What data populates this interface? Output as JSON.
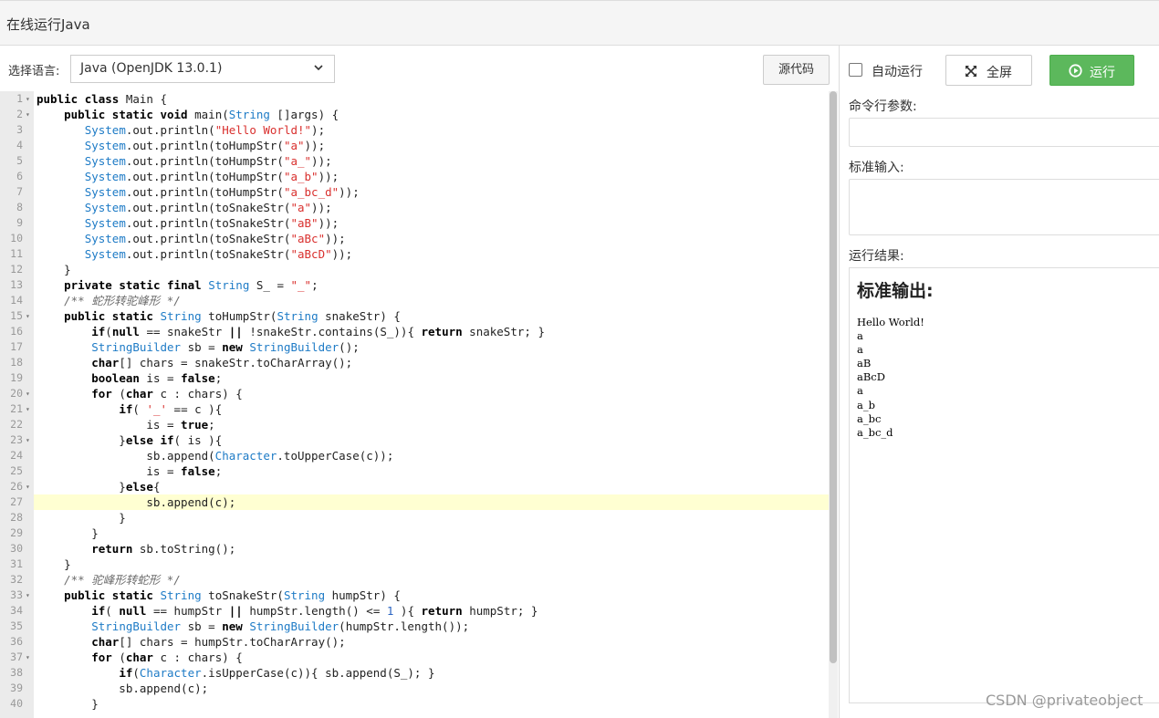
{
  "header": {
    "title": "在线运行Java"
  },
  "language": {
    "label": "选择语言:",
    "selected": "Java (OpenJDK 13.0.1)"
  },
  "toolbar": {
    "source_label": "源代码",
    "auto_run_label": "自动运行",
    "fullscreen_label": "全屏",
    "run_label": "运行",
    "run_color": "#5cb85c"
  },
  "editor": {
    "active_line": 27,
    "lines": [
      {
        "n": "1",
        "fold": true,
        "html": "<span class=\"kw\">public</span> <span class=\"kw\">class</span> Main {"
      },
      {
        "n": "2",
        "fold": true,
        "html": "    <span class=\"kw\">public</span> <span class=\"kw\">static</span> <span class=\"kw\">void</span> main(<span class=\"ty\">String</span> []args) {"
      },
      {
        "n": "3",
        "fold": false,
        "html": "       <span class=\"ty\">System</span>.out.println(<span class=\"st\">\"Hello World!\"</span>);"
      },
      {
        "n": "4",
        "fold": false,
        "html": "       <span class=\"ty\">System</span>.out.println(toHumpStr(<span class=\"st\">\"a\"</span>));"
      },
      {
        "n": "5",
        "fold": false,
        "html": "       <span class=\"ty\">System</span>.out.println(toHumpStr(<span class=\"st\">\"a_\"</span>));"
      },
      {
        "n": "6",
        "fold": false,
        "html": "       <span class=\"ty\">System</span>.out.println(toHumpStr(<span class=\"st\">\"a_b\"</span>));"
      },
      {
        "n": "7",
        "fold": false,
        "html": "       <span class=\"ty\">System</span>.out.println(toHumpStr(<span class=\"st\">\"a_bc_d\"</span>));"
      },
      {
        "n": "8",
        "fold": false,
        "html": "       <span class=\"ty\">System</span>.out.println(toSnakeStr(<span class=\"st\">\"a\"</span>));"
      },
      {
        "n": "9",
        "fold": false,
        "html": "       <span class=\"ty\">System</span>.out.println(toSnakeStr(<span class=\"st\">\"aB\"</span>));"
      },
      {
        "n": "10",
        "fold": false,
        "html": "       <span class=\"ty\">System</span>.out.println(toSnakeStr(<span class=\"st\">\"aBc\"</span>));"
      },
      {
        "n": "11",
        "fold": false,
        "html": "       <span class=\"ty\">System</span>.out.println(toSnakeStr(<span class=\"st\">\"aBcD\"</span>));"
      },
      {
        "n": "12",
        "fold": false,
        "html": "    }"
      },
      {
        "n": "13",
        "fold": false,
        "html": "    <span class=\"kw\">private</span> <span class=\"kw\">static</span> <span class=\"kw\">final</span> <span class=\"ty\">String</span> S_ = <span class=\"st\">\"_\"</span>;"
      },
      {
        "n": "14",
        "fold": false,
        "html": "    <span class=\"cm\">/** 蛇形转驼峰形 */</span>"
      },
      {
        "n": "15",
        "fold": true,
        "html": "    <span class=\"kw\">public</span> <span class=\"kw\">static</span> <span class=\"ty\">String</span> toHumpStr(<span class=\"ty\">String</span> snakeStr) {"
      },
      {
        "n": "16",
        "fold": false,
        "html": "        <span class=\"kw\">if</span>(<span class=\"kw\">null</span> == snakeStr <span class=\"kw\">||</span> !snakeStr.contains(S_)){ <span class=\"kw\">return</span> snakeStr; }"
      },
      {
        "n": "17",
        "fold": false,
        "html": "        <span class=\"ty\">StringBuilder</span> sb = <span class=\"kw\">new</span> <span class=\"ty\">StringBuilder</span>();"
      },
      {
        "n": "18",
        "fold": false,
        "html": "        <span class=\"kw\">char</span>[] chars = snakeStr.toCharArray();"
      },
      {
        "n": "19",
        "fold": false,
        "html": "        <span class=\"kw\">boolean</span> is = <span class=\"kw\">false</span>;"
      },
      {
        "n": "20",
        "fold": true,
        "html": "        <span class=\"kw\">for</span> (<span class=\"kw\">char</span> c : chars) {"
      },
      {
        "n": "21",
        "fold": true,
        "html": "            <span class=\"kw\">if</span>( <span class=\"st\">'_'</span> == c ){"
      },
      {
        "n": "22",
        "fold": false,
        "html": "                is = <span class=\"kw\">true</span>;"
      },
      {
        "n": "23",
        "fold": true,
        "html": "            }<span class=\"kw\">else</span> <span class=\"kw\">if</span>( is ){"
      },
      {
        "n": "24",
        "fold": false,
        "html": "                sb.append(<span class=\"ty\">Character</span>.toUpperCase(c));"
      },
      {
        "n": "25",
        "fold": false,
        "html": "                is = <span class=\"kw\">false</span>;"
      },
      {
        "n": "26",
        "fold": true,
        "html": "            }<span class=\"kw\">else</span>{"
      },
      {
        "n": "27",
        "fold": false,
        "html": "                sb.append(c);"
      },
      {
        "n": "28",
        "fold": false,
        "html": "            }"
      },
      {
        "n": "29",
        "fold": false,
        "html": "        }"
      },
      {
        "n": "30",
        "fold": false,
        "html": "        <span class=\"kw\">return</span> sb.toString();"
      },
      {
        "n": "31",
        "fold": false,
        "html": "    }"
      },
      {
        "n": "32",
        "fold": false,
        "html": "    <span class=\"cm\">/** 驼峰形转蛇形 */</span>"
      },
      {
        "n": "33",
        "fold": true,
        "html": "    <span class=\"kw\">public</span> <span class=\"kw\">static</span> <span class=\"ty\">String</span> toSnakeStr(<span class=\"ty\">String</span> humpStr) {"
      },
      {
        "n": "34",
        "fold": false,
        "html": "        <span class=\"kw\">if</span>( <span class=\"kw\">null</span> == humpStr <span class=\"kw\">||</span> humpStr.length() <= <span class=\"nm\">1</span> ){ <span class=\"kw\">return</span> humpStr; }"
      },
      {
        "n": "35",
        "fold": false,
        "html": "        <span class=\"ty\">StringBuilder</span> sb = <span class=\"kw\">new</span> <span class=\"ty\">StringBuilder</span>(humpStr.length());"
      },
      {
        "n": "36",
        "fold": false,
        "html": "        <span class=\"kw\">char</span>[] chars = humpStr.toCharArray();"
      },
      {
        "n": "37",
        "fold": true,
        "html": "        <span class=\"kw\">for</span> (<span class=\"kw\">char</span> c : chars) {"
      },
      {
        "n": "38",
        "fold": false,
        "html": "            <span class=\"kw\">if</span>(<span class=\"ty\">Character</span>.isUpperCase(c)){ sb.append(S_); }"
      },
      {
        "n": "39",
        "fold": false,
        "html": "            sb.append(c);"
      },
      {
        "n": "40",
        "fold": false,
        "html": "        }"
      }
    ]
  },
  "params": {
    "args_label": "命令行参数:",
    "args_value": "",
    "stdin_label": "标准输入:",
    "stdin_value": ""
  },
  "result": {
    "label": "运行结果:",
    "heading": "标准输出:",
    "output_lines": [
      "Hello World!",
      "a",
      "a",
      "aB",
      "aBcD",
      "a",
      "a_b",
      "a_bc",
      "a_bc_d"
    ]
  },
  "watermark": "CSDN @privateobject"
}
